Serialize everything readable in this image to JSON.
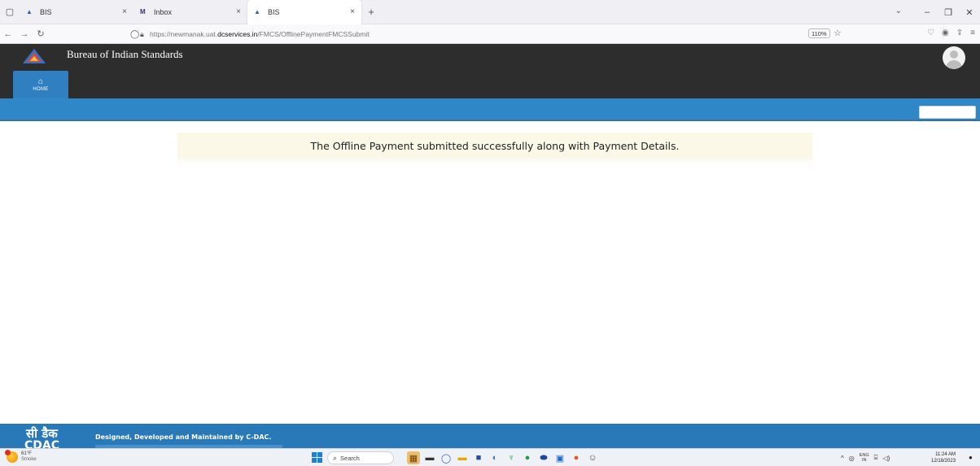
{
  "browser": {
    "tabs": [
      {
        "title": "BIS",
        "icon": "bis-logo-icon",
        "active": false
      },
      {
        "title": "Inbox",
        "icon": "inbox-icon",
        "active": false
      },
      {
        "title": "BIS",
        "icon": "bis-logo-icon",
        "active": true
      }
    ],
    "tab_close_glyph": "×",
    "new_tab_glyph": "+",
    "url_prefix": "https://newmanak.uat.",
    "url_domain": "dcservices.in",
    "url_path": "/FMCS/OfflinePaymentFMCSSubmit",
    "zoom": "110%"
  },
  "app": {
    "title": "Bureau of Indian Standards",
    "home_label": "HOME",
    "header_bg": "#2d2d2d",
    "accent": "#2f87c8"
  },
  "message": {
    "text": "The Offline Payment submitted successfully along with Payment Details.",
    "bg": "#fcf8e8"
  },
  "footer": {
    "logo_text": "सी डैक",
    "logo_sub": "CDAC",
    "text": "Designed, Developed and Maintained by C-DAC."
  },
  "taskbar": {
    "weather_temp": "61°F",
    "weather_cond": "Smoke",
    "search_placeholder": "Search",
    "lang_top": "ENG",
    "lang_bottom": "IN",
    "time": "11:24 AM",
    "date": "12/18/2023"
  }
}
